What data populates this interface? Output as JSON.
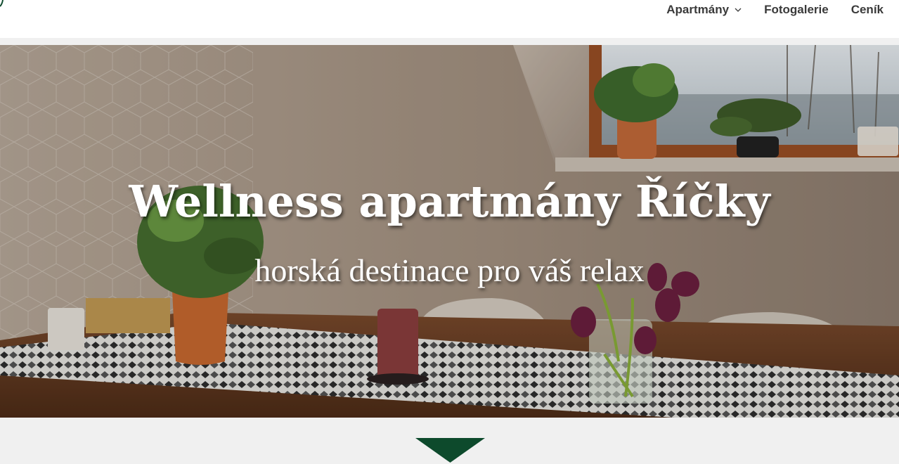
{
  "nav": {
    "items": [
      {
        "label": "Apartmány",
        "has_dropdown": true
      },
      {
        "label": "Fotogalerie",
        "has_dropdown": false
      },
      {
        "label": "Ceník",
        "has_dropdown": false
      }
    ]
  },
  "hero": {
    "title": "Wellness apartmány Říčky",
    "subtitle": "horská destinace pro váš relax"
  },
  "colors": {
    "brand_green": "#0d4a2c",
    "nav_text": "#3a3a3a",
    "section_bg": "#f0f0f0"
  },
  "icons": {
    "dropdown": "chevron-down-icon",
    "scroll": "triangle-down-icon"
  }
}
